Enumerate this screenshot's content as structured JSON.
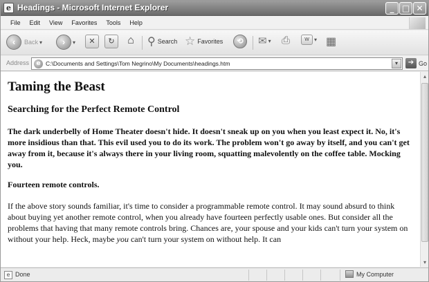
{
  "window": {
    "title": "Headings - Microsoft Internet Explorer",
    "controls": [
      "_",
      "□",
      "✕"
    ]
  },
  "menu": [
    "File",
    "Edit",
    "View",
    "Favorites",
    "Tools",
    "Help"
  ],
  "toolbar": {
    "back_label": "Back",
    "search_label": "Search",
    "favorites_label": "Favorites"
  },
  "address": {
    "label": "Address",
    "value": "C:\\Documents and Settings\\Tom Negrino\\My Documents\\headings.htm",
    "go_label": "Go"
  },
  "page": {
    "h1": "Taming the Beast",
    "h2": "Searching for the Perfect Remote Control",
    "bold_paragraph": "The dark underbelly of Home Theater doesn't hide. It doesn't sneak up on you when you least expect it. No, it's more insidious than that. This evil used you to do its work. The problem won't go away by itself, and you can't get away from it, because it's always there in your living room, squatting malevolently on the coffee table. Mocking you.",
    "h4": "Fourteen remote controls.",
    "body_before": "If the above story sounds familiar, it's time to consider a programmable remote control. It may sound absurd to think about buying yet another remote control, when you already have fourteen perfectly usable ones. But consider all the problems that having that many remote controls bring. Chances are, your spouse and your kids can't turn your system on without your help. Heck, maybe ",
    "body_em": "you",
    "body_after": " can't turn your system on without help. It can"
  },
  "status": {
    "text": "Done",
    "zone": "My Computer"
  }
}
